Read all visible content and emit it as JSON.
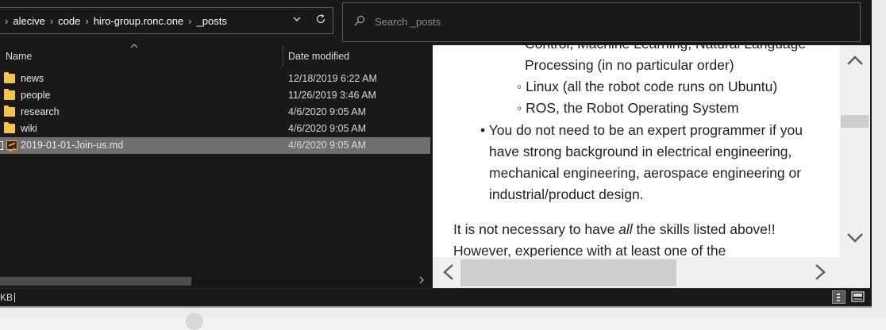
{
  "address": {
    "crumbs": [
      "alecive",
      "code",
      "hiro-group.ronc.one",
      "_posts"
    ]
  },
  "search": {
    "placeholder": "Search _posts"
  },
  "columns": {
    "name": "Name",
    "date": "Date modified"
  },
  "files": [
    {
      "name": "news",
      "date": "12/18/2019 6:22 AM",
      "type": "folder"
    },
    {
      "name": "people",
      "date": "11/26/2019 3:46 AM",
      "type": "folder"
    },
    {
      "name": "research",
      "date": "4/6/2020 9:05 AM",
      "type": "folder"
    },
    {
      "name": "wiki",
      "date": "4/6/2020 9:05 AM",
      "type": "folder"
    },
    {
      "name": "2019-01-01-Join-us.md",
      "date": "4/6/2020 9:05 AM",
      "type": "file",
      "selected": true
    }
  ],
  "preview": {
    "lines": [
      "Control, Machine Learning, Natural Language",
      "Processing (in no particular order)",
      "◦ Linux (all the robot code runs on Ubuntu)",
      "◦ ROS, the Robot Operating System",
      "• You do not need to be an expert programmer if you",
      "have strong background in electrical engineering,",
      "mechanical engineering, aerospace engineering or",
      "industrial/product design.",
      "It is not necessary to have ",
      "all",
      " the skills listed above!!",
      "However, experience with at least one of the"
    ]
  },
  "status": {
    "text": "KB"
  },
  "colors": {
    "selection": "#6f6f6f",
    "folder": "#f5c34a",
    "background": "#191919"
  }
}
